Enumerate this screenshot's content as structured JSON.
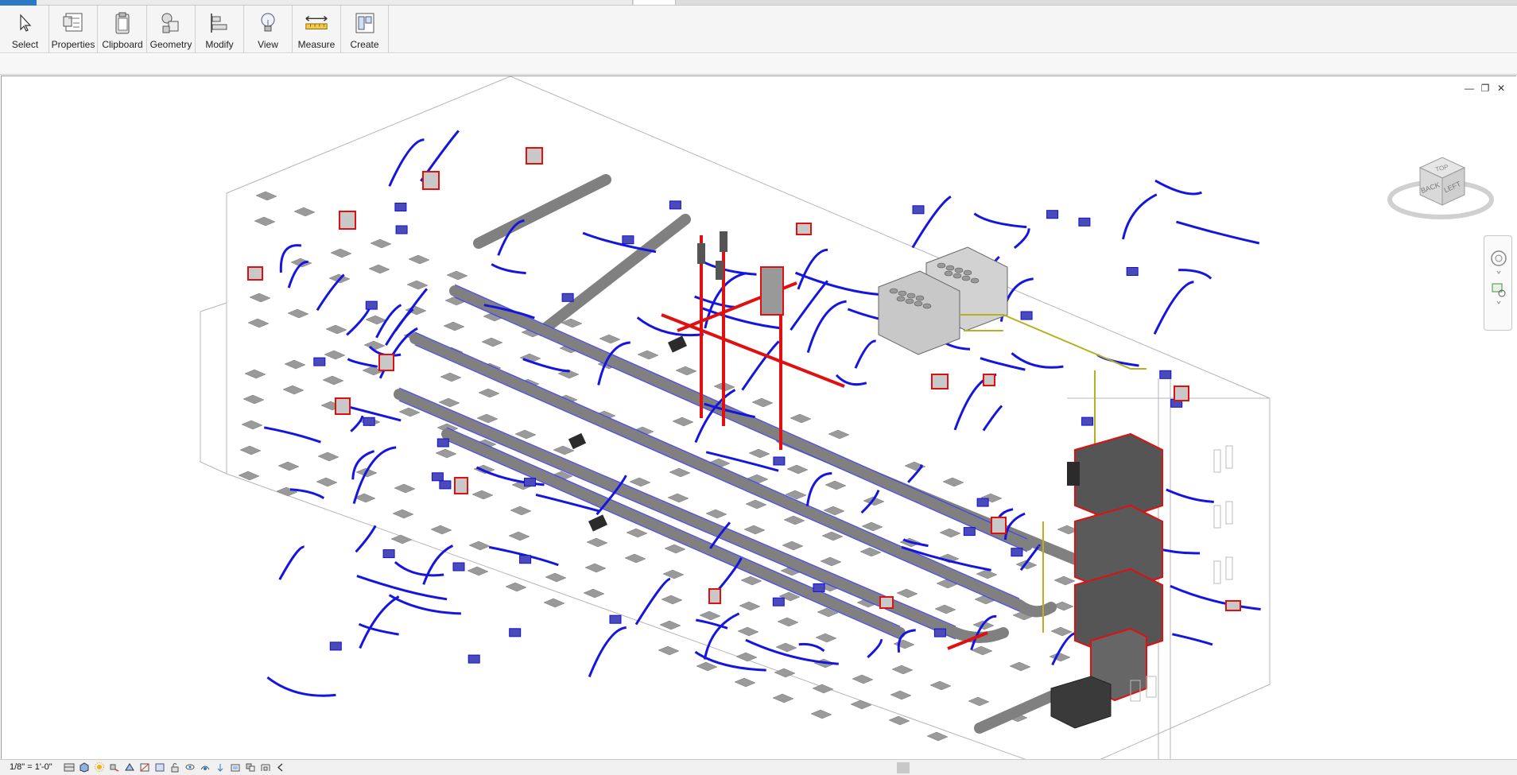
{
  "ribbon": {
    "buttons": [
      {
        "label": "Select",
        "icon": "cursor-arrow-icon"
      },
      {
        "label": "Properties",
        "icon": "properties-icon"
      },
      {
        "label": "Clipboard",
        "icon": "clipboard-icon"
      },
      {
        "label": "Geometry",
        "icon": "geometry-icon"
      },
      {
        "label": "Modify",
        "icon": "align-modify-icon"
      },
      {
        "label": "View",
        "icon": "lightbulb-icon"
      },
      {
        "label": "Measure",
        "icon": "measure-ruler-icon"
      },
      {
        "label": "Create",
        "icon": "create-panels-icon"
      }
    ]
  },
  "viewcube": {
    "faces": {
      "top": "TOP",
      "front": "BACK",
      "side": "LEFT"
    }
  },
  "statusbar": {
    "scale": "1/8\" = 1'-0\"",
    "view_control_icons": [
      "detail-level-icon",
      "visual-style-icon",
      "sun-path-icon",
      "shadows-icon",
      "render-icon",
      "crop-view-icon",
      "show-crop-icon",
      "unlock-3d-icon",
      "temporary-hide-icon",
      "reveal-hidden-icon",
      "worksharing-icon",
      "analytical-icon",
      "highlight-displacement-icon",
      "constraints-icon",
      "scroll-left-icon"
    ]
  },
  "colors": {
    "duct_blue": "#1010d8",
    "duct_red": "#e01010",
    "duct_gray": "#8a8a8a",
    "pipe_yellow": "#b8b020",
    "accent_tab": "#2b79c2"
  }
}
